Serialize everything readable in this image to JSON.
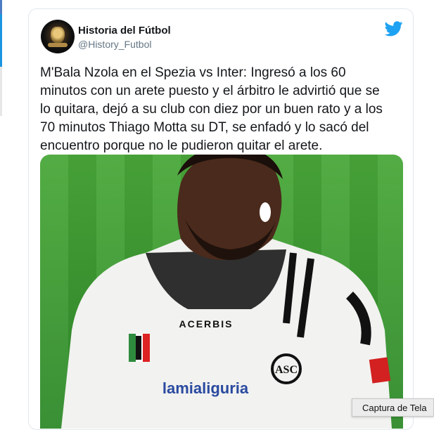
{
  "tweet": {
    "author_name": "Historia del Fútbol",
    "author_handle": "@History_Futbol",
    "text": "M'Bala Nzola en el Spezia vs Inter: Ingresó a los 60\nminutos con un arete puesto y el árbitro le advirtió que se\nlo quitara, dejó a su club con diez por un buen rato y a los\n70 minutos Thiago Motta su DT, se enfadó y lo sacó del\nencuentro porque no le pudieron quitar el arete.",
    "photo": {
      "sponsor_sleeve": "ACERBIS",
      "sponsor_chest": "lamialiguria",
      "crest_text": "ASC"
    }
  },
  "tooltip": {
    "label": "Captura de Tela"
  },
  "colors": {
    "twitter_blue": "#1da1f2",
    "text": "#14171a",
    "handle": "#657786"
  },
  "icons": [
    "twitter-bird-icon",
    "avatar-logo-icon"
  ]
}
